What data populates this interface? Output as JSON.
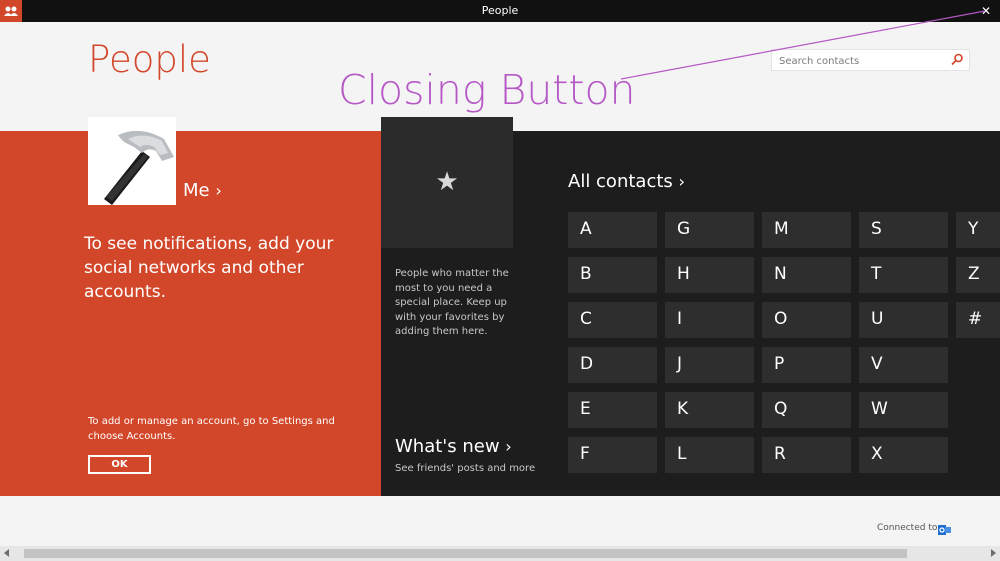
{
  "window": {
    "title": "People",
    "close_glyph": "✕",
    "app_icon": "people-icon"
  },
  "header": {
    "title": "People",
    "search": {
      "placeholder": "Search contacts",
      "icon": "search-icon"
    }
  },
  "annotation": {
    "label": "Closing Button",
    "color": "#b558c6"
  },
  "me_panel": {
    "me_label": "Me",
    "chevron": "›",
    "notifications_text": "To see notifications, add your social networks and other accounts.",
    "manage_text": "To add or manage an account, go to Settings and choose Accounts.",
    "ok_label": "OK",
    "avatar": "hammer-icon",
    "bg_color": "#d2472a"
  },
  "favorites": {
    "icon": "star-icon",
    "star_glyph": "★",
    "text": "People who matter the most to you need a special place. Keep up with your favorites by adding them here."
  },
  "whats_new": {
    "label": "What's new",
    "chevron": "›",
    "subtitle": "See friends' posts and more"
  },
  "contacts": {
    "label": "All contacts",
    "chevron": "›",
    "letters": [
      "A",
      "B",
      "C",
      "D",
      "E",
      "F",
      "G",
      "H",
      "I",
      "J",
      "K",
      "L",
      "M",
      "N",
      "O",
      "P",
      "Q",
      "R",
      "S",
      "T",
      "U",
      "V",
      "W",
      "X",
      "Y",
      "Z",
      "#"
    ]
  },
  "footer": {
    "connected_label": "Connected to",
    "service_icon": "outlook-icon"
  }
}
